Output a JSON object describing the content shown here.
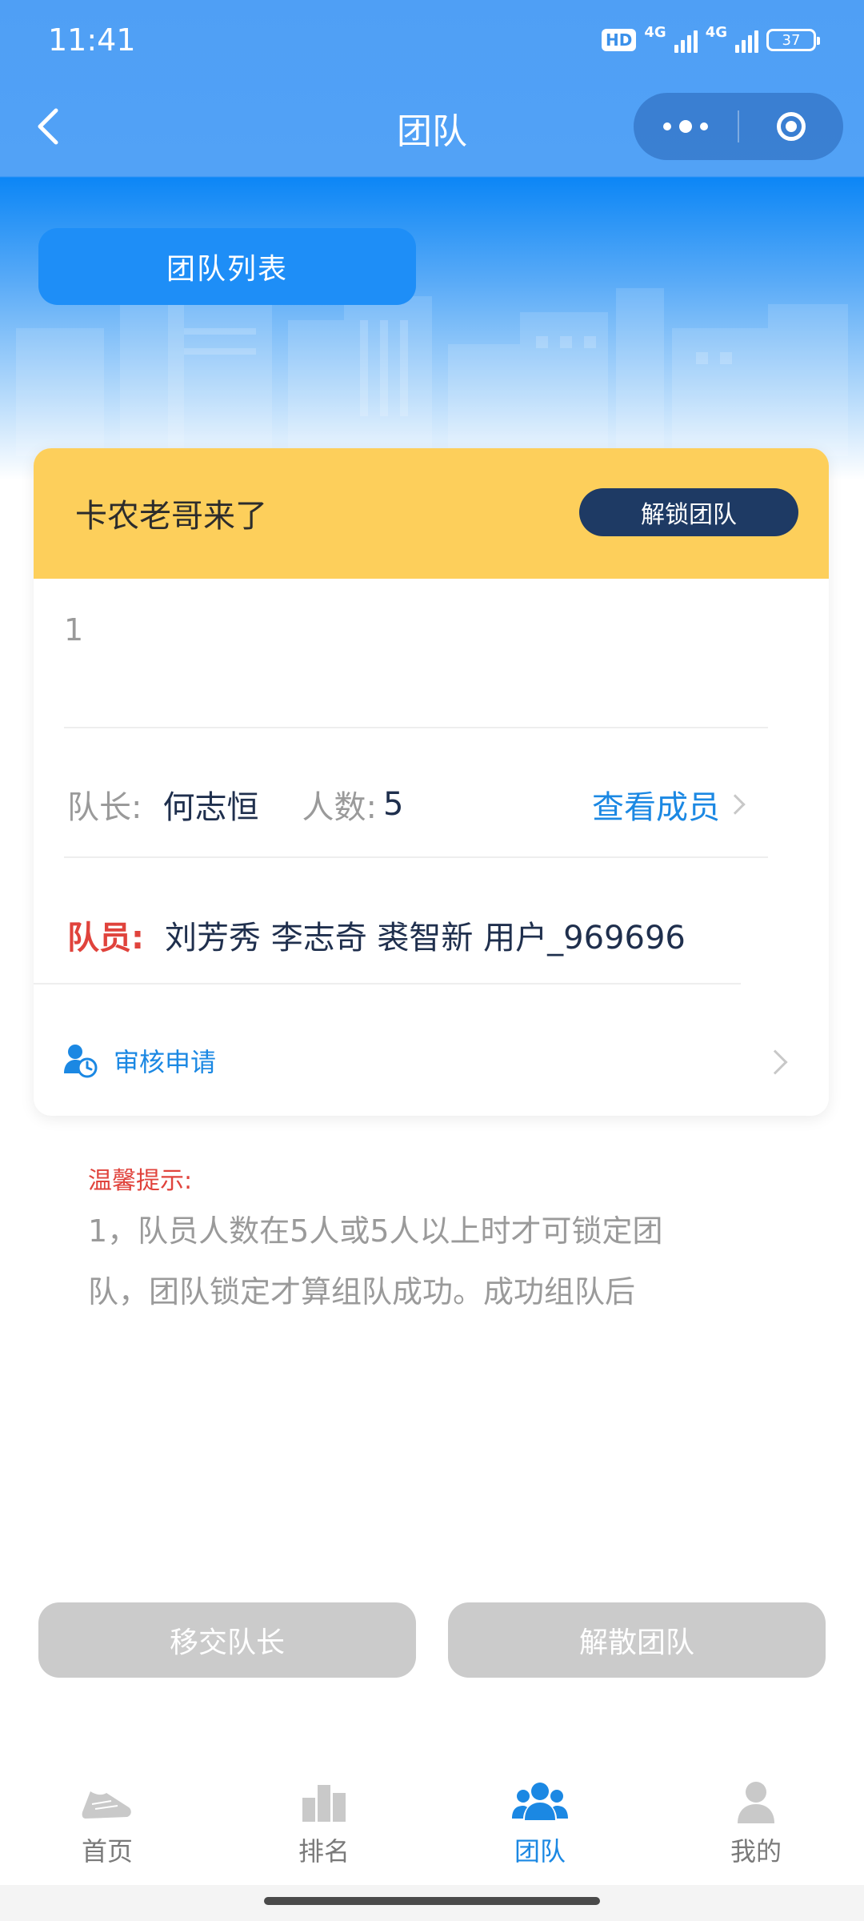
{
  "status_bar": {
    "time": "11:41",
    "hd": "HD",
    "network1": "4G",
    "network2": "4G",
    "battery": "37"
  },
  "nav": {
    "title": "团队"
  },
  "team_list_button": "团队列表",
  "team": {
    "name": "卡农老哥来了",
    "unlock_label": "解锁团队",
    "description": "1",
    "leader_label": "队长:",
    "leader_name": "何志恒",
    "count_label": "人数:",
    "count_value": "5",
    "view_members_label": "查看成员",
    "members_label": "队员:",
    "members": "刘芳秀 李志奇 裘智新 用户_969696",
    "review_label": "审核申请"
  },
  "tips": {
    "title": "温馨提示:",
    "line1": "1，队员人数在5人或5人以上时才可锁定团",
    "line2": "队，团队锁定才算组队成功。成功组队后"
  },
  "actions": {
    "transfer_leader": "移交队长",
    "dissolve_team": "解散团队"
  },
  "tabbar": [
    {
      "label": "首页",
      "icon": "shoe-icon",
      "active": false
    },
    {
      "label": "排名",
      "icon": "ranking-icon",
      "active": false
    },
    {
      "label": "团队",
      "icon": "team-icon",
      "active": true
    },
    {
      "label": "我的",
      "icon": "profile-icon",
      "active": false
    }
  ],
  "colors": {
    "header_blue": "#4f9ff5",
    "primary_blue": "#1e8ef7",
    "card_head_yellow": "#fdcf5b",
    "unlock_navy": "#1e3a64",
    "link_blue": "#1b88e3",
    "alert_red": "#e0433c",
    "disabled_gray": "#cbcbcb"
  }
}
